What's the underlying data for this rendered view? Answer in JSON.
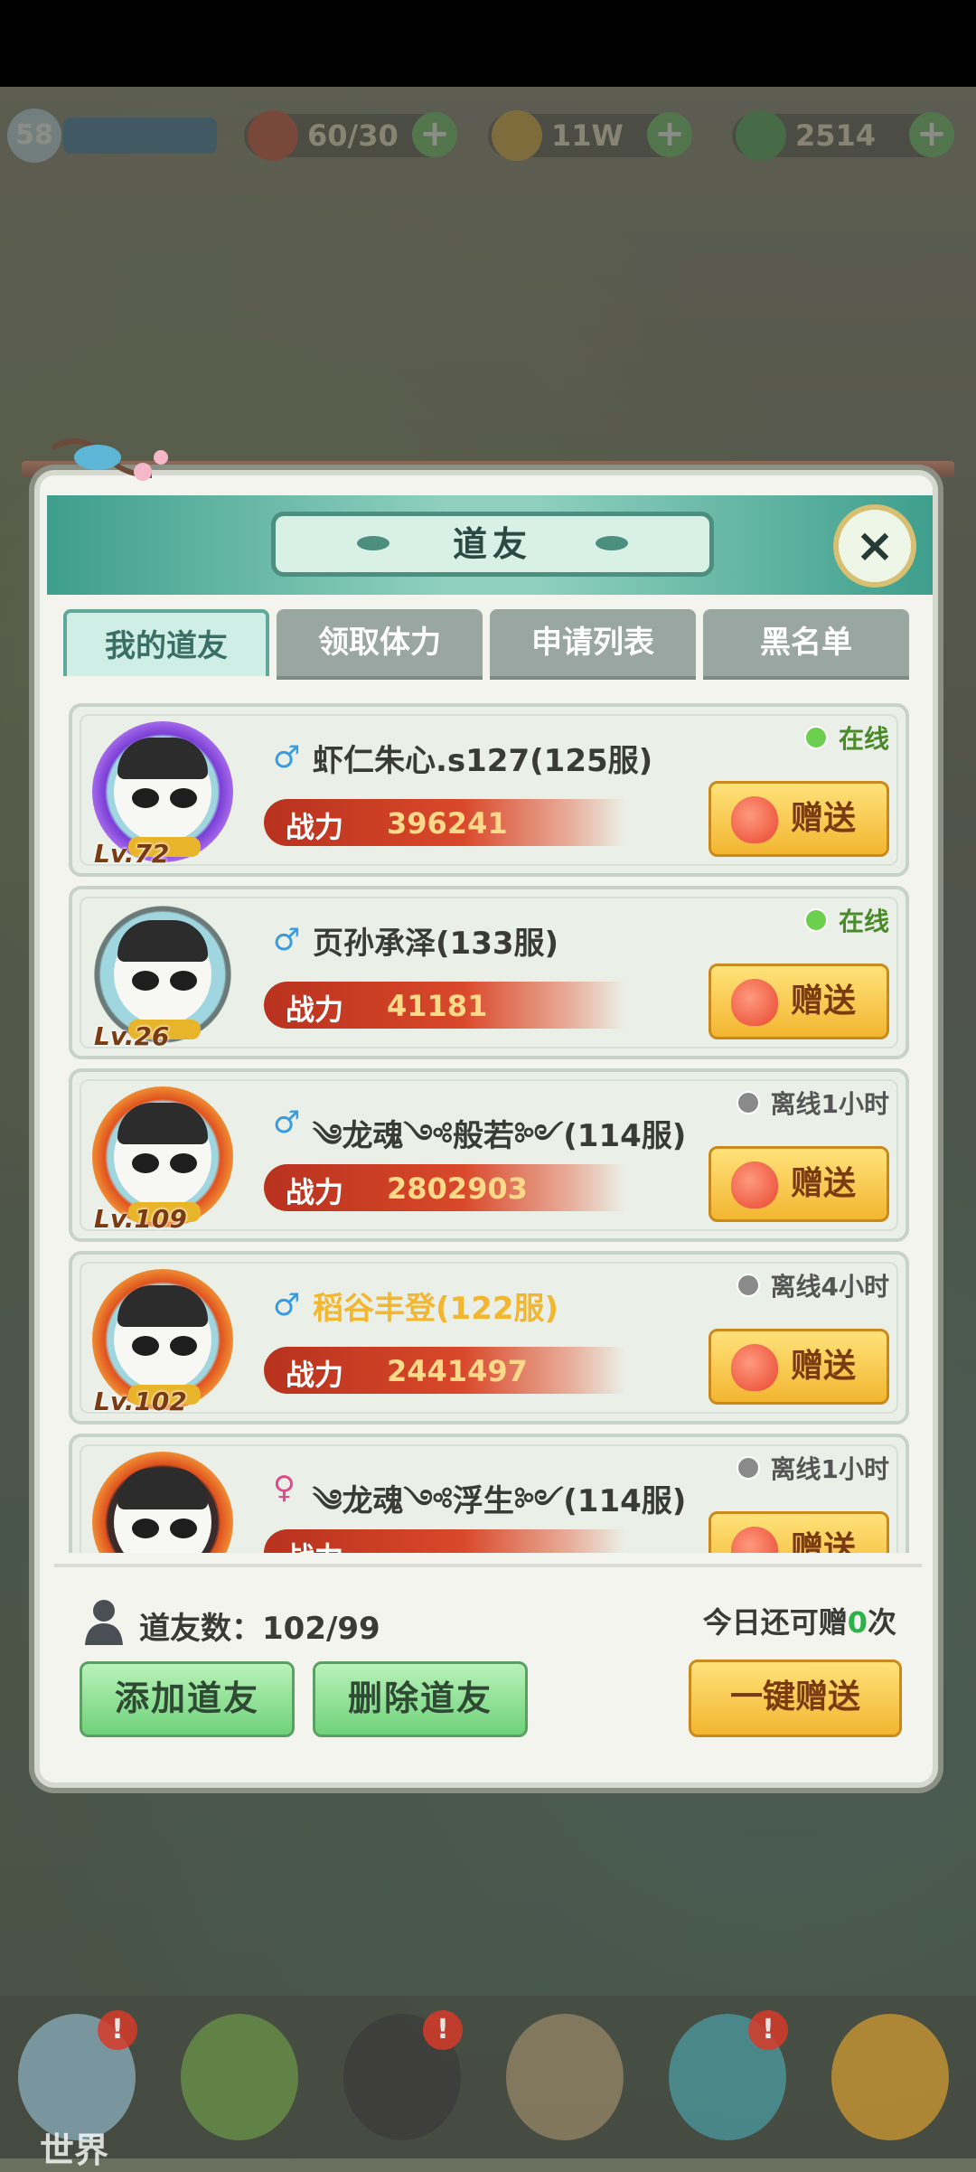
{
  "hud": {
    "level": "58",
    "stamina": "60/30",
    "gold": "11W",
    "jade": "2514",
    "plus": "+"
  },
  "dialog": {
    "title": "道友",
    "close_icon": "×"
  },
  "tabs": [
    {
      "label": "我的道友",
      "active": true
    },
    {
      "label": "领取体力",
      "active": false
    },
    {
      "label": "申请列表",
      "active": false
    },
    {
      "label": "黑名单",
      "active": false
    }
  ],
  "friends": [
    {
      "gender": "♂",
      "name": "虾仁朱心.s127(125服)",
      "level": "Lv.72",
      "power_label": "战力",
      "power": "396241",
      "status": "在线",
      "online": true,
      "gift_label": "赠送"
    },
    {
      "gender": "♂",
      "name": "页孙承泽(133服)",
      "level": "Lv.26",
      "power_label": "战力",
      "power": "41181",
      "status": "在线",
      "online": true,
      "gift_label": "赠送"
    },
    {
      "gender": "♂",
      "name": "༄龙魂༺般若༻(114服)",
      "level": "Lv.109",
      "power_label": "战力",
      "power": "2802903",
      "status": "离线1小时",
      "online": false,
      "gift_label": "赠送"
    },
    {
      "gender": "♂",
      "name": "稻谷丰登(122服)",
      "level": "Lv.102",
      "power_label": "战力",
      "power": "2441497",
      "status": "离线4小时",
      "online": false,
      "gift_label": "赠送"
    },
    {
      "gender": "♀",
      "name": "༄龙魂༺浮生༻(114服)",
      "level": "",
      "power_label": "战力",
      "power": "",
      "status": "离线1小时",
      "online": false,
      "gift_label": "赠送"
    }
  ],
  "footer": {
    "friend_count_label": "道友数：102/99",
    "remaining_prefix": "今日还可赠",
    "remaining_count": "0",
    "remaining_suffix": "次",
    "add_friend": "添加道友",
    "delete_friend": "删除道友",
    "gift_all": "一键赠送"
  },
  "bottom_nav": {
    "world_label": "世界",
    "badge": "!"
  },
  "colors": {
    "online": "#6ccf4e",
    "offline": "#8a8a8a",
    "male": "#3a9be0",
    "female": "#e04a8a",
    "name_default": "#3a3a36",
    "name_highlight": "#f3b631"
  }
}
